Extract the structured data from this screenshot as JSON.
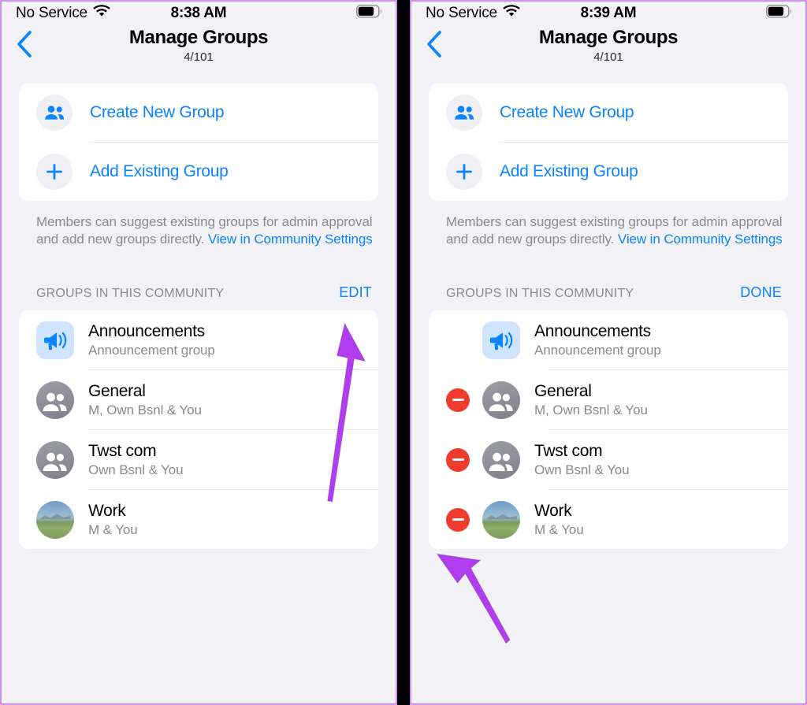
{
  "accent": {
    "blue": "#0a84ff",
    "red": "#ef3b2d",
    "arrow_purple": "#b23cf0",
    "page_bg": "#f2f1f6",
    "card_bg": "#ffffff",
    "muted_text": "#8a8a8f",
    "panel_border": "#cf8ff5"
  },
  "panels": [
    {
      "id": "left",
      "status_bar": {
        "carrier": "No Service",
        "wifi_icon": "wifi-icon",
        "time": "8:38 AM",
        "battery_icon": "battery-icon"
      },
      "nav": {
        "back_icon": "chevron-left-icon",
        "title": "Manage Groups",
        "subtitle": "4/101"
      },
      "actions": [
        {
          "icon": "two-people-icon",
          "label": "Create New Group"
        },
        {
          "icon": "plus-icon",
          "label": "Add Existing Group"
        }
      ],
      "footnote": {
        "text": "Members can suggest existing groups for admin approval and add new groups directly. ",
        "link": "View in Community Settings"
      },
      "section": {
        "title": "GROUPS IN THIS COMMUNITY",
        "action": "EDIT"
      },
      "edit_mode": false,
      "groups": [
        {
          "name": "Announcements",
          "subtitle": "Announcement group",
          "avatar": "megaphone-icon",
          "avatar_style": "announcement",
          "deletable": false
        },
        {
          "name": "General",
          "subtitle": "M, Own Bsnl & You",
          "avatar": "people-group-icon",
          "avatar_style": "people",
          "deletable": true
        },
        {
          "name": "Twst com",
          "subtitle": "Own Bsnl & You",
          "avatar": "people-group-icon",
          "avatar_style": "people",
          "deletable": true
        },
        {
          "name": "Work",
          "subtitle": "M & You",
          "avatar": "landscape-photo",
          "avatar_style": "photo",
          "deletable": true
        }
      ],
      "annotation": {
        "arrow": "arrow-pointing-to-edit-button"
      }
    },
    {
      "id": "right",
      "status_bar": {
        "carrier": "No Service",
        "wifi_icon": "wifi-icon",
        "time": "8:39 AM",
        "battery_icon": "battery-icon"
      },
      "nav": {
        "back_icon": "chevron-left-icon",
        "title": "Manage Groups",
        "subtitle": "4/101"
      },
      "actions": [
        {
          "icon": "two-people-icon",
          "label": "Create New Group"
        },
        {
          "icon": "plus-icon",
          "label": "Add Existing Group"
        }
      ],
      "footnote": {
        "text": "Members can suggest existing groups for admin approval and add new groups directly. ",
        "link": "View in Community Settings"
      },
      "section": {
        "title": "GROUPS IN THIS COMMUNITY",
        "action": "DONE"
      },
      "edit_mode": true,
      "groups": [
        {
          "name": "Announcements",
          "subtitle": "Announcement group",
          "avatar": "megaphone-icon",
          "avatar_style": "announcement",
          "deletable": false
        },
        {
          "name": "General",
          "subtitle": "M, Own Bsnl & You",
          "avatar": "people-group-icon",
          "avatar_style": "people",
          "deletable": true
        },
        {
          "name": "Twst com",
          "subtitle": "Own Bsnl & You",
          "avatar": "people-group-icon",
          "avatar_style": "people",
          "deletable": true
        },
        {
          "name": "Work",
          "subtitle": "M & You",
          "avatar": "landscape-photo",
          "avatar_style": "photo",
          "deletable": true
        }
      ],
      "annotation": {
        "arrow": "arrow-pointing-to-remove-button"
      }
    }
  ]
}
